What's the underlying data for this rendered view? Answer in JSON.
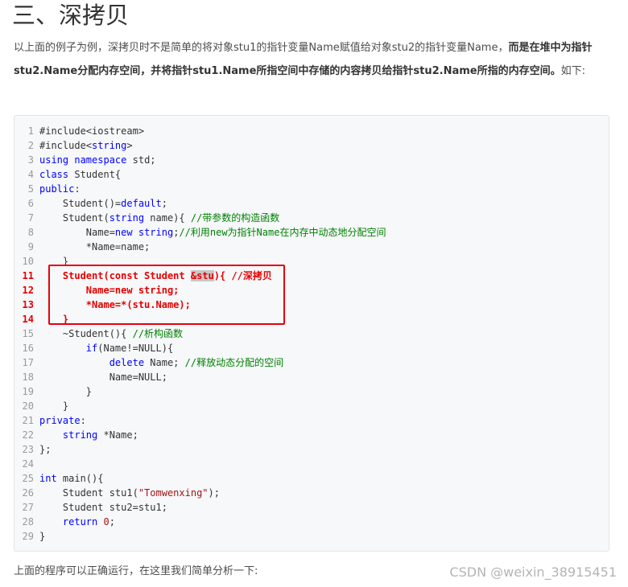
{
  "section": {
    "title": "三、深拷贝"
  },
  "intro": {
    "text_normal_1": "以上面的例子为例，深拷贝时不是简单的将对象stu1的指针变量Name赋值给对象stu2的指针变量Name，",
    "text_bold": "而是在堆中为指针stu2.Name分配内存空间，并将指针stu1.Name所指空间中存储的内容拷贝给指针stu2.Name所指的内存空间。",
    "text_normal_2": "如下:"
  },
  "code": {
    "lines": [
      {
        "n": "1",
        "html": "#include&lt;iostream&gt;"
      },
      {
        "n": "2",
        "html": "#include&lt;<span class='tok-kw'>string</span>&gt;"
      },
      {
        "n": "3",
        "html": "<span class='tok-kw'>using</span> <span class='tok-kw'>namespace</span> std;"
      },
      {
        "n": "4",
        "html": "<span class='tok-kw'>class</span> Student{"
      },
      {
        "n": "5",
        "html": "<span class='tok-kw'>public</span>:"
      },
      {
        "n": "6",
        "html": "    Student()=<span class='tok-kw'>default</span>;"
      },
      {
        "n": "7",
        "html": "    Student(<span class='tok-kw'>string</span> name){ <span class='tok-cm'>//带参数的构造函数</span>"
      },
      {
        "n": "8",
        "html": "        Name=<span class='tok-kw'>new</span> <span class='tok-kw'>string</span>;<span class='tok-cm'>//利用new为指针Name在内存中动态地分配空间</span>"
      },
      {
        "n": "9",
        "html": "        *Name=name;"
      },
      {
        "n": "10",
        "html": "    }"
      },
      {
        "n": "11",
        "hl": true,
        "html": "    Student(const Student <span class='tok-sel'>&amp;stu</span>){ //深拷贝"
      },
      {
        "n": "12",
        "hl": true,
        "html": "        Name=new string;"
      },
      {
        "n": "13",
        "hl": true,
        "html": "        *Name=*(stu.Name);"
      },
      {
        "n": "14",
        "hl": true,
        "html": "    }"
      },
      {
        "n": "15",
        "html": "    ~Student(){ <span class='tok-cm'>//析构函数</span>"
      },
      {
        "n": "16",
        "html": "        <span class='tok-kw'>if</span>(Name!=NULL){"
      },
      {
        "n": "17",
        "html": "            <span class='tok-kw'>delete</span> Name; <span class='tok-cm'>//释放动态分配的空间</span>"
      },
      {
        "n": "18",
        "html": "            Name=NULL;"
      },
      {
        "n": "19",
        "html": "        }"
      },
      {
        "n": "20",
        "html": "    }"
      },
      {
        "n": "21",
        "html": "<span class='tok-kw'>private</span>:"
      },
      {
        "n": "22",
        "html": "    <span class='tok-kw'>string</span> *Name;"
      },
      {
        "n": "23",
        "html": "};"
      },
      {
        "n": "24",
        "html": ""
      },
      {
        "n": "25",
        "html": "<span class='tok-kw'>int</span> main(){"
      },
      {
        "n": "26",
        "html": "    Student stu1(<span class='tok-str'>\"Tomwenxing\"</span>);"
      },
      {
        "n": "27",
        "html": "    Student stu2=stu1;"
      },
      {
        "n": "28",
        "html": "    <span class='tok-kw'>return</span> <span class='tok-str'>0</span>;"
      },
      {
        "n": "29",
        "html": "}"
      }
    ]
  },
  "after": {
    "text": "上面的程序可以正确运行，在这里我们简单分析一下:"
  },
  "watermark": {
    "text": "CSDN @weixin_38915451"
  },
  "colors": {
    "keyword": "#0000ff",
    "comment": "#008000",
    "highlight": "#e60000",
    "box": "#e8000b"
  }
}
